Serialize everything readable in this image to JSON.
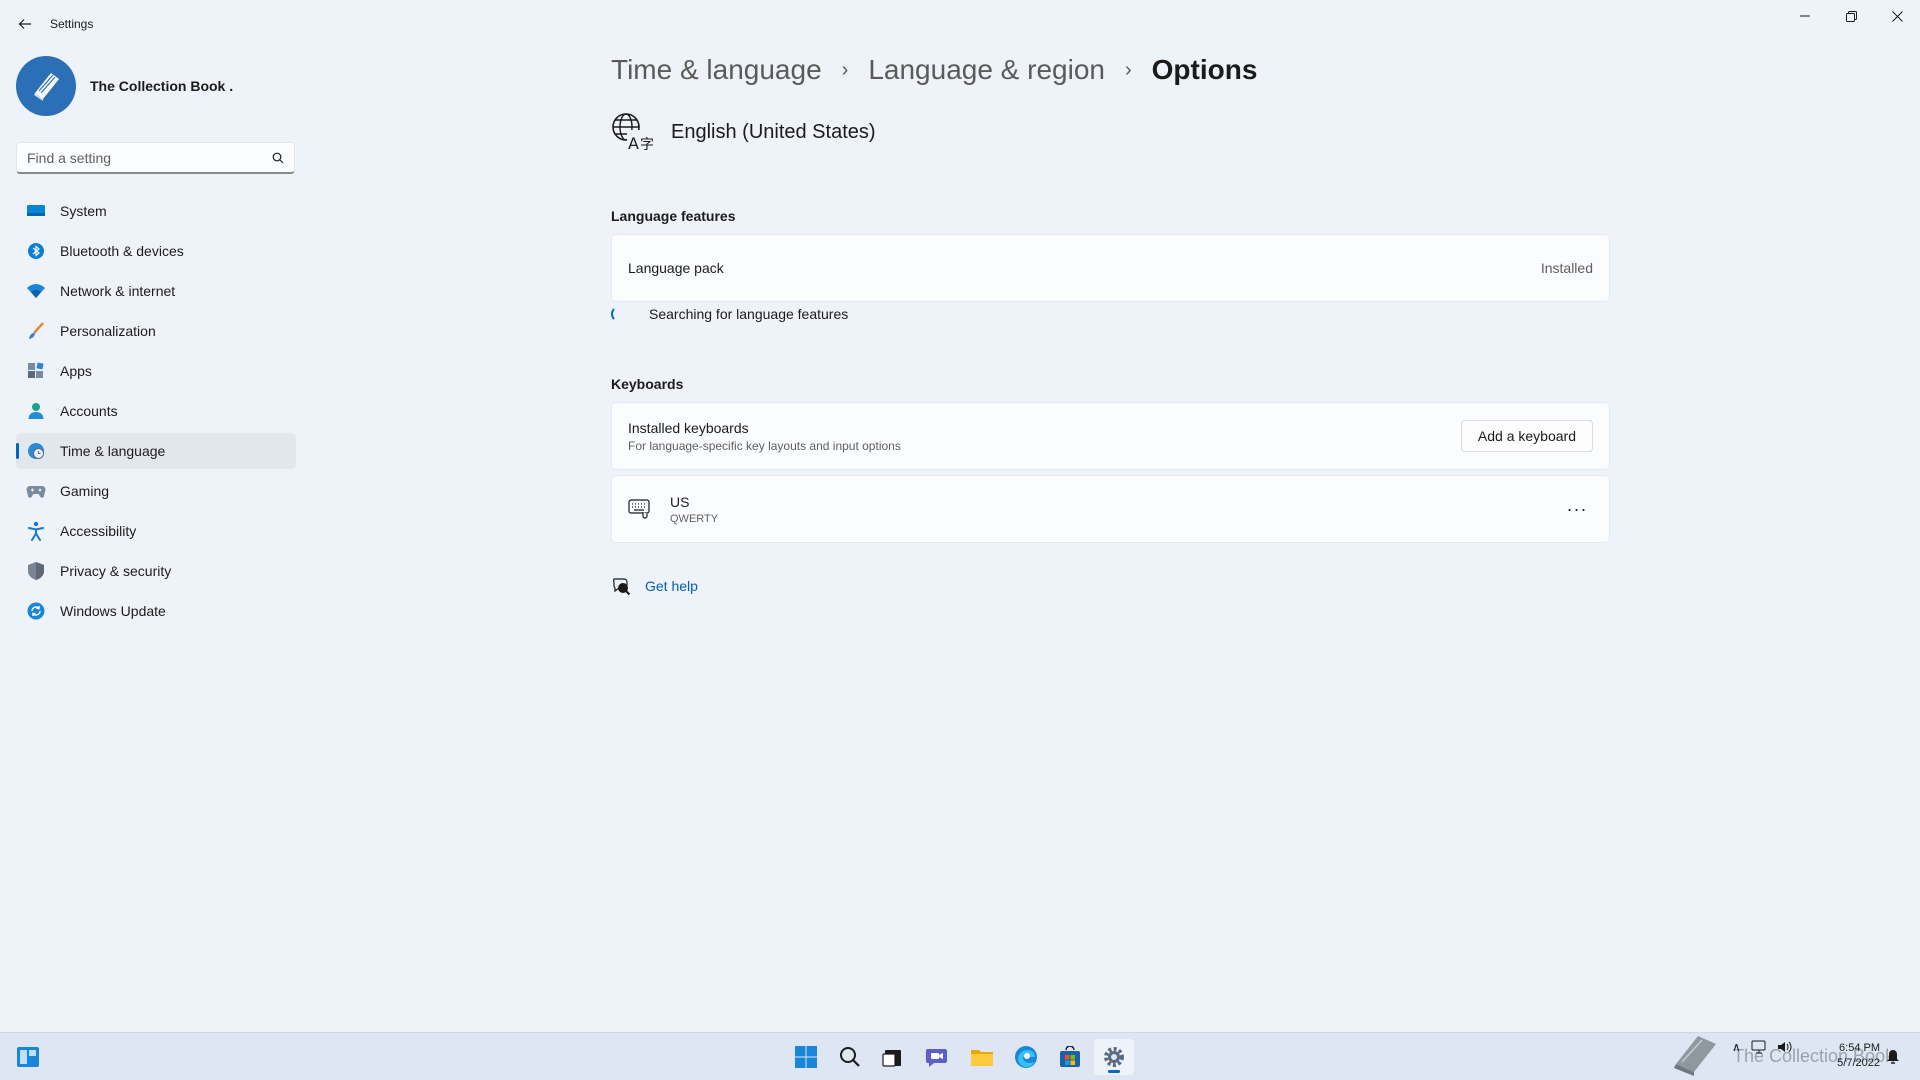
{
  "window": {
    "title": "Settings"
  },
  "profile": {
    "name": "The Collection Book ."
  },
  "search": {
    "placeholder": "Find a setting"
  },
  "sidebar": {
    "items": [
      {
        "label": "System",
        "icon": "monitor-icon"
      },
      {
        "label": "Bluetooth & devices",
        "icon": "bluetooth-icon"
      },
      {
        "label": "Network & internet",
        "icon": "wifi-icon"
      },
      {
        "label": "Personalization",
        "icon": "brush-icon"
      },
      {
        "label": "Apps",
        "icon": "apps-icon"
      },
      {
        "label": "Accounts",
        "icon": "person-icon"
      },
      {
        "label": "Time & language",
        "icon": "globe-clock-icon",
        "active": true
      },
      {
        "label": "Gaming",
        "icon": "gamepad-icon"
      },
      {
        "label": "Accessibility",
        "icon": "accessibility-icon"
      },
      {
        "label": "Privacy & security",
        "icon": "shield-icon"
      },
      {
        "label": "Windows Update",
        "icon": "update-icon"
      }
    ]
  },
  "breadcrumb": {
    "items": [
      "Time & language",
      "Language & region",
      "Options"
    ]
  },
  "language": {
    "name": "English (United States)"
  },
  "features": {
    "section_title": "Language features",
    "language_pack": {
      "title": "Language pack",
      "status": "Installed"
    },
    "searching_text": "Searching for language features"
  },
  "keyboards": {
    "section_title": "Keyboards",
    "installed": {
      "title": "Installed keyboards",
      "subtitle": "For language-specific key layouts and input options",
      "button": "Add a keyboard"
    },
    "list": [
      {
        "name": "US",
        "layout": "QWERTY",
        "more": "···"
      }
    ]
  },
  "help": {
    "label": "Get help"
  },
  "taskbar": {
    "clock": {
      "time": "6:54 PM",
      "date": "5/7/2022"
    },
    "watermark": "The Collection Book"
  },
  "colors": {
    "accent": "#0067c0",
    "background": "#eef3f9",
    "card": "#fbfcfe"
  }
}
